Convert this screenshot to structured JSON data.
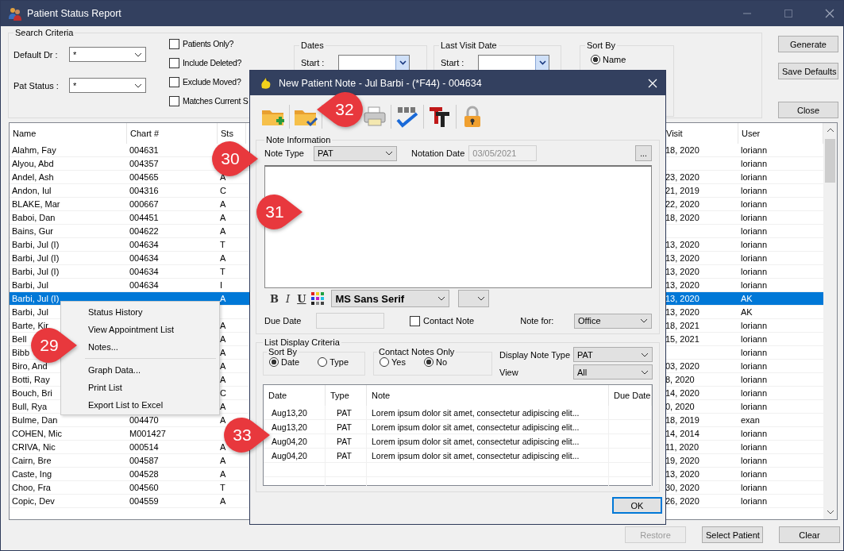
{
  "window": {
    "title": "Patient Status Report"
  },
  "search_criteria": {
    "title": "Search Criteria",
    "default_dr": {
      "label": "Default Dr :",
      "value": "*"
    },
    "pat_status": {
      "label": "Pat Status :",
      "value": "*"
    },
    "checkboxes": [
      {
        "label": "Patients Only?",
        "checked": false
      },
      {
        "label": "Include Deleted?",
        "checked": false
      },
      {
        "label": "Exclude Moved?",
        "checked": false
      },
      {
        "label": "Matches Current S",
        "checked": false
      }
    ],
    "dates": {
      "title": "Dates",
      "start_label": "Start :"
    },
    "last_visit_date": {
      "title": "Last Visit Date",
      "start_label": "Start :"
    },
    "sort_by": {
      "title": "Sort By",
      "options": [
        {
          "label": "Name",
          "selected": true
        }
      ]
    }
  },
  "buttons": [
    "Generate",
    "Save Defaults",
    "Close"
  ],
  "table": {
    "columns": [
      "Name",
      "Chart #",
      "Sts",
      "Visit",
      "User"
    ],
    "rows": [
      {
        "name": "Alahm, Fay",
        "chart": "004631",
        "visit": "18, 2020",
        "user": "loriann",
        "selected": false
      },
      {
        "name": "Alyou, Abd",
        "chart": "004357",
        "user": "loriann",
        "selected": false
      },
      {
        "name": "Andel, Ash",
        "chart": "004565",
        "sts": "A",
        "visit": "23, 2020",
        "user": "loriann",
        "selected": false
      },
      {
        "name": "Andon, Iul",
        "chart": "004316",
        "sts": "C",
        "visit": "21, 2019",
        "user": "loriann",
        "selected": false
      },
      {
        "name": "BLAKE, Mar",
        "chart": "000667",
        "sts": "A",
        "visit": "22, 2020",
        "user": "loriann",
        "selected": false
      },
      {
        "name": "Baboi, Dan",
        "chart": "004451",
        "sts": "A",
        "visit": "18, 2020",
        "user": "loriann",
        "selected": false
      },
      {
        "name": "Bains, Gur",
        "chart": "004622",
        "sts": "A",
        "user": "loriann",
        "selected": false
      },
      {
        "name": "Barbi, Jul (I)",
        "chart": "004634",
        "sts": "T",
        "visit": "13, 2020",
        "user": "loriann",
        "selected": false
      },
      {
        "name": "Barbi, Jul (I)",
        "chart": "004634",
        "sts": "A",
        "visit": "13, 2020",
        "user": "loriann",
        "selected": false
      },
      {
        "name": "Barbi, Jul (I)",
        "chart": "004634",
        "sts": "T",
        "visit": "13, 2020",
        "user": "loriann",
        "selected": false
      },
      {
        "name": "Barbi, Jul",
        "chart": "004634",
        "sts": "I",
        "visit": "13, 2020",
        "user": "loriann",
        "selected": false
      },
      {
        "name": "Barbi, Jul (I)",
        "sts": "A",
        "visit": "13, 2020",
        "user": "AK",
        "selected": true
      },
      {
        "name": "Barbi, Jul",
        "visit": "13, 2020",
        "user": "AK",
        "selected": false
      },
      {
        "name": "Barte, Kir",
        "sts": "A",
        "visit": "18, 2021",
        "user": "loriann",
        "selected": false
      },
      {
        "name": "Bell",
        "sts": "A",
        "visit": "15, 2021",
        "user": "loriann",
        "selected": false
      },
      {
        "name": "Bibb",
        "sts": "A",
        "user": "loriann",
        "selected": false
      },
      {
        "name": "Biro, And",
        "sts": "A",
        "visit": "03, 2020",
        "user": "loriann",
        "selected": false
      },
      {
        "name": "Botti, Ray",
        "sts": "A",
        "visit": "8, 2020",
        "user": "loriann",
        "selected": false
      },
      {
        "name": "Bouch, Bri",
        "sts": "C",
        "visit": "14, 2020",
        "user": "loriann",
        "selected": false
      },
      {
        "name": "Bull, Rya",
        "sts": "A",
        "visit": "0, 2020",
        "user": "loriann",
        "selected": false
      },
      {
        "name": "Bulme, Dan",
        "chart": "004470",
        "sts": "A",
        "visit": "18, 2019",
        "user": "exan",
        "selected": false
      },
      {
        "name": "COHEN, Mic",
        "chart": "M001427",
        "visit": "14, 2014",
        "user": "loriann",
        "selected": false
      },
      {
        "name": "CRIVA, Nic",
        "chart": "000514",
        "sts": "A",
        "visit": "11, 2020",
        "user": "loriann",
        "selected": false
      },
      {
        "name": "Cairn, Bre",
        "chart": "004587",
        "sts": "A",
        "visit": "19, 2020",
        "user": "loriann",
        "selected": false
      },
      {
        "name": "Caste, Ing",
        "chart": "004528",
        "sts": "A",
        "visit": "13, 2020",
        "user": "loriann",
        "selected": false
      },
      {
        "name": "Choo, Fra",
        "chart": "004560",
        "sts": "T",
        "visit": "30, 2020",
        "user": "loriann",
        "selected": false
      },
      {
        "name": "Copic, Dev",
        "chart": "004559",
        "sts": "A",
        "visit": "26, 2020",
        "user": "loriann",
        "selected": false
      }
    ]
  },
  "context_menu": {
    "sections": [
      [
        "Status History",
        "View Appointment List",
        "Notes..."
      ],
      [
        "Graph Data...",
        "Print List",
        "Export List to Excel"
      ]
    ]
  },
  "bottom_buttons": [
    {
      "label": "Restore",
      "disabled": true
    },
    {
      "label": "Select Patient",
      "disabled": false
    },
    {
      "label": "Clear",
      "disabled": false
    }
  ],
  "dialog": {
    "title": "New Patient Note - Jul Barbi - (*F44) - 004634",
    "note_information": {
      "title": "Note Information",
      "note_type_label": "Note Type",
      "note_type": "PAT",
      "notation_date_label": "Notation Date",
      "notation_date": {
        "value": "03/05/2021",
        "disabled": true
      },
      "browse_button": "...",
      "format_buttons": [
        {
          "label": "B",
          "kind": "bold"
        },
        {
          "label": "I",
          "kind": "italic"
        },
        {
          "label": "U",
          "kind": "underline"
        }
      ],
      "font": "MS Sans Serif",
      "due_date_label": "Due Date",
      "contact_note": {
        "label": "Contact Note",
        "checked": false
      },
      "note_for_label": "Note for:",
      "note_for": "Office"
    },
    "list_display_criteria": {
      "title": "List Display Criteria",
      "sort_by": {
        "title": "Sort By",
        "options": [
          {
            "label": "Date",
            "selected": true
          },
          {
            "label": "Type",
            "selected": false
          }
        ]
      },
      "contact_notes_only": {
        "title": "Contact Notes Only",
        "options": [
          {
            "label": "Yes",
            "selected": false
          },
          {
            "label": "No",
            "selected": true
          }
        ]
      },
      "display_note_type_label": "Display Note Type",
      "display_note_type": "PAT",
      "view_label": "View",
      "view": "All"
    },
    "notes_table": {
      "columns": [
        "Date",
        "Type",
        "Note",
        "Due Date"
      ],
      "rows": [
        {
          "date": "Aug13,20",
          "type": "PAT",
          "note": "Lorem ipsum dolor sit amet, consectetur adipiscing elit..."
        },
        {
          "date": "Aug13,20",
          "type": "PAT",
          "note": "Lorem ipsum dolor sit amet, consectetur adipiscing elit..."
        },
        {
          "date": "Aug04,20",
          "type": "PAT",
          "note": "Lorem ipsum dolor sit amet, consectetur adipiscing elit..."
        },
        {
          "date": "Aug04,20",
          "type": "PAT",
          "note": "Lorem ipsum dolor sit amet, consectetur adipiscing elit..."
        }
      ]
    },
    "ok_button": "OK"
  },
  "callouts": [
    {
      "label": "29",
      "kind": "right"
    },
    {
      "label": "30",
      "kind": "right"
    },
    {
      "label": "31",
      "kind": "right"
    },
    {
      "label": "32",
      "kind": "left"
    },
    {
      "label": "33",
      "kind": "right"
    }
  ]
}
